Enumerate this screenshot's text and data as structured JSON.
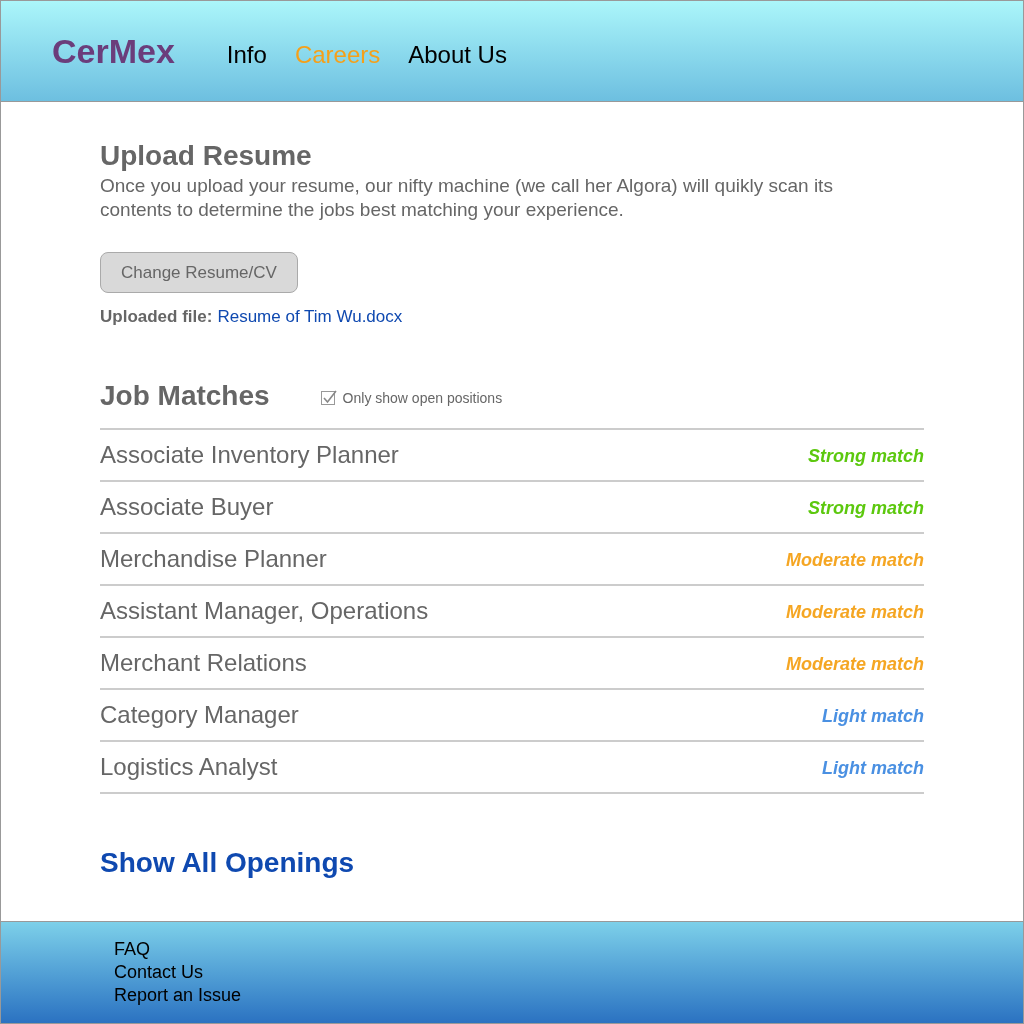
{
  "header": {
    "logo": "CerMex",
    "nav": [
      {
        "label": "Info",
        "selected": false
      },
      {
        "label": "Careers",
        "selected": true
      },
      {
        "label": "About Us",
        "selected": false
      }
    ]
  },
  "upload": {
    "title": "Upload Resume",
    "description": "Once you upload your resume, our nifty machine (we call her Algora) will quikly scan its contents to determine the jobs best matching your experience.",
    "button": "Change Resume/CV",
    "file_label": "Uploaded file:",
    "file_name": "Resume of Tim Wu.docx"
  },
  "job_matches": {
    "title": "Job Matches",
    "filter": {
      "label": "Only show open positions",
      "checked": true
    },
    "rows": [
      {
        "title": "Associate Inventory Planner",
        "match": "Strong match",
        "color": "#5cc80e"
      },
      {
        "title": "Associate Buyer",
        "match": "Strong match",
        "color": "#5cc80e"
      },
      {
        "title": "Merchandise Planner",
        "match": "Moderate match",
        "color": "#f5a623"
      },
      {
        "title": "Assistant Manager, Operations",
        "match": "Moderate match",
        "color": "#f5a623"
      },
      {
        "title": "Merchant Relations",
        "match": "Moderate match",
        "color": "#f5a623"
      },
      {
        "title": "Category Manager",
        "match": "Light match",
        "color": "#4a90e2"
      },
      {
        "title": "Logistics Analyst",
        "match": "Light match",
        "color": "#4a90e2"
      }
    ]
  },
  "show_all": "Show All Openings",
  "footer": {
    "links": [
      "FAQ",
      "Contact Us",
      "Report an Issue"
    ]
  }
}
